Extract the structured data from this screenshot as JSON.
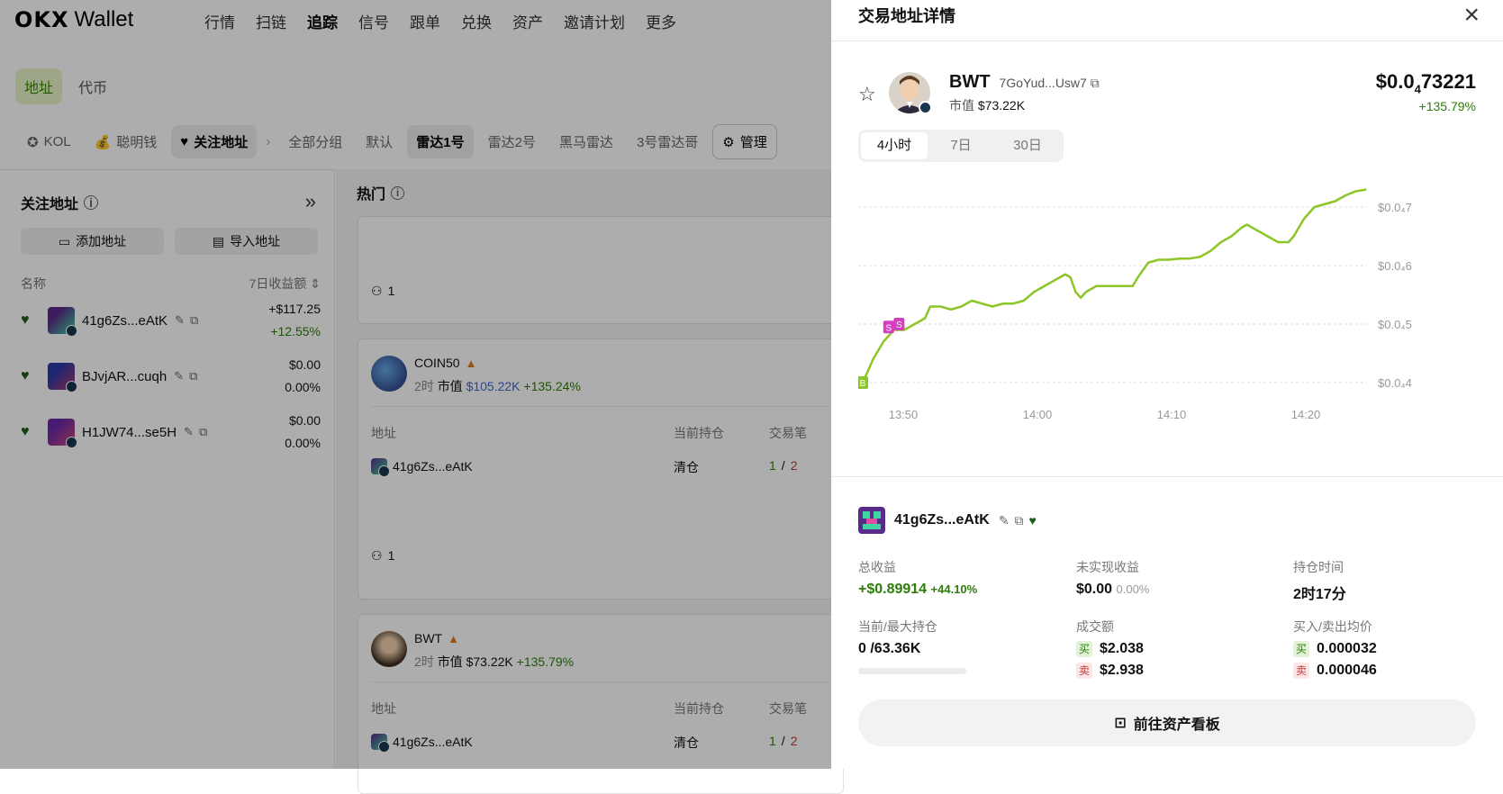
{
  "nav": {
    "brand": "OKX",
    "product": "Wallet",
    "items": [
      "行情",
      "扫链",
      "追踪",
      "信号",
      "跟单",
      "兑换",
      "资产",
      "邀请计划",
      "更多"
    ],
    "active_index": 2
  },
  "subtabs": [
    "地址",
    "代币"
  ],
  "groups": {
    "kol": "KOL",
    "smart": "聪明钱",
    "watch": "关注地址",
    "items": [
      "全部分组",
      "默认",
      "雷达1号",
      "雷达2号",
      "黑马雷达",
      "3号雷达哥"
    ],
    "selected": "雷达1号",
    "manage": "管理"
  },
  "left": {
    "title": "关注地址",
    "add_btn": "添加地址",
    "import_btn": "导入地址",
    "col_name": "名称",
    "col_pnl": "7日收益额",
    "wallets": [
      {
        "name": "41g6Zs...eAtK",
        "pnl": "+$117.25",
        "pct": "+12.55%",
        "color1": "#5a2a8a",
        "color2": "#3dd6a0"
      },
      {
        "name": "BJvjAR...cuqh",
        "pnl": "$0.00",
        "pct": "0.00%",
        "color1": "#2a3aa8",
        "color2": "#b03a6a"
      },
      {
        "name": "H1JW74...se5H",
        "pnl": "$0.00",
        "pct": "0.00%",
        "color1": "#6a2aa8",
        "color2": "#d04a7a"
      }
    ]
  },
  "middle": {
    "title": "热门",
    "count": "1",
    "cards": [
      {
        "token": "COIN50",
        "age": "2时",
        "cap_label": "市值",
        "cap": "$105.22K",
        "change": "+135.24%",
        "col_addr": "地址",
        "col_hold": "当前持仓",
        "col_trade": "交易笔",
        "row_addr": "41g6Zs...eAtK",
        "row_hold": "清仓",
        "row_buy": "1",
        "row_sell": "2",
        "count": "1"
      },
      {
        "token": "BWT",
        "age": "2时",
        "cap_label": "市值",
        "cap": "$73.22K",
        "change": "+135.79%",
        "col_addr": "地址",
        "col_hold": "当前持仓",
        "col_trade": "交易笔",
        "row_addr": "41g6Zs...eAtK",
        "row_hold": "清仓",
        "row_buy": "1",
        "row_sell": "2"
      }
    ]
  },
  "drawer": {
    "title": "交易地址详情",
    "token": "BWT",
    "address": "7GoYud...Usw7",
    "cap_label": "市值",
    "cap": "$73.22K",
    "price_prefix": "$0.0",
    "price_sub": "4",
    "price_tail": "73221",
    "price_change": "+135.79%",
    "ranges": [
      "4小时",
      "7日",
      "30日"
    ],
    "selected_range": 0,
    "wallet": "41g6Zs...eAtK",
    "stats": {
      "total_label": "总收益",
      "total": "+$0.89914",
      "total_pct": "+44.10%",
      "unreal_label": "未实现收益",
      "unreal": "$0.00",
      "unreal_pct": "0.00%",
      "hold_label": "持仓时间",
      "hold": "2时17分",
      "pos_label": "当前/最大持仓",
      "pos": "0 /63.36K",
      "vol_label": "成交额",
      "vol_buy": "$2.038",
      "vol_sell": "$2.938",
      "avg_label": "买入/卖出均价",
      "avg_buy": "0.000032",
      "avg_sell": "0.000046",
      "buy_tag": "买",
      "sell_tag": "卖",
      "position_fill": 0
    },
    "cta": "前往资产看板"
  },
  "chart_data": {
    "type": "line",
    "title": "",
    "x_ticks": [
      "13:50",
      "14:00",
      "14:10",
      "14:20"
    ],
    "y_ticks": [
      {
        "label": "$0.0₄4",
        "value": 0.4
      },
      {
        "label": "$0.0₄5",
        "value": 0.5
      },
      {
        "label": "$0.0₄6",
        "value": 0.6
      },
      {
        "label": "$0.0₄7",
        "value": 0.7
      }
    ],
    "ylim": [
      0.4,
      0.7
    ],
    "x_minutes_range": [
      13.47,
      14.45
    ],
    "grid": true,
    "line_color": "#8cc628",
    "series": [
      {
        "values": [
          [
            13.47,
            0.4
          ],
          [
            13.49,
            0.44
          ],
          [
            13.51,
            0.47
          ],
          [
            13.53,
            0.49
          ],
          [
            13.55,
            0.49
          ],
          [
            13.57,
            0.5
          ],
          [
            13.59,
            0.51
          ],
          [
            13.6,
            0.53
          ],
          [
            13.62,
            0.53
          ],
          [
            13.64,
            0.525
          ],
          [
            13.66,
            0.53
          ],
          [
            13.68,
            0.54
          ],
          [
            13.7,
            0.535
          ],
          [
            13.72,
            0.53
          ],
          [
            13.74,
            0.535
          ],
          [
            13.76,
            0.535
          ],
          [
            13.78,
            0.54
          ],
          [
            13.8,
            0.555
          ],
          [
            13.82,
            0.565
          ],
          [
            13.84,
            0.575
          ],
          [
            13.86,
            0.585
          ],
          [
            13.87,
            0.58
          ],
          [
            13.88,
            0.555
          ],
          [
            13.89,
            0.545
          ],
          [
            13.9,
            0.555
          ],
          [
            13.92,
            0.565
          ],
          [
            13.94,
            0.565
          ],
          [
            13.96,
            0.565
          ],
          [
            13.98,
            0.565
          ],
          [
            13.99,
            0.565
          ],
          [
            14.0,
            0.58
          ],
          [
            14.02,
            0.605
          ],
          [
            14.04,
            0.61
          ],
          [
            14.06,
            0.61
          ],
          [
            14.08,
            0.612
          ],
          [
            14.1,
            0.612
          ],
          [
            14.12,
            0.615
          ],
          [
            14.14,
            0.625
          ],
          [
            14.16,
            0.64
          ],
          [
            14.18,
            0.65
          ],
          [
            14.2,
            0.665
          ],
          [
            14.21,
            0.67
          ],
          [
            14.23,
            0.66
          ],
          [
            14.25,
            0.65
          ],
          [
            14.27,
            0.64
          ],
          [
            14.29,
            0.64
          ],
          [
            14.3,
            0.65
          ],
          [
            14.32,
            0.68
          ],
          [
            14.34,
            0.7
          ],
          [
            14.36,
            0.705
          ],
          [
            14.38,
            0.71
          ],
          [
            14.4,
            0.72
          ],
          [
            14.42,
            0.727
          ],
          [
            14.44,
            0.73
          ]
        ]
      }
    ],
    "markers": [
      {
        "x": 13.47,
        "y": 0.4,
        "label": "B",
        "color": "#8cc628"
      },
      {
        "x": 13.52,
        "y": 0.495,
        "label": "S",
        "color": "#d43fbf"
      },
      {
        "x": 13.54,
        "y": 0.5,
        "label": "S",
        "color": "#d43fbf"
      }
    ]
  }
}
